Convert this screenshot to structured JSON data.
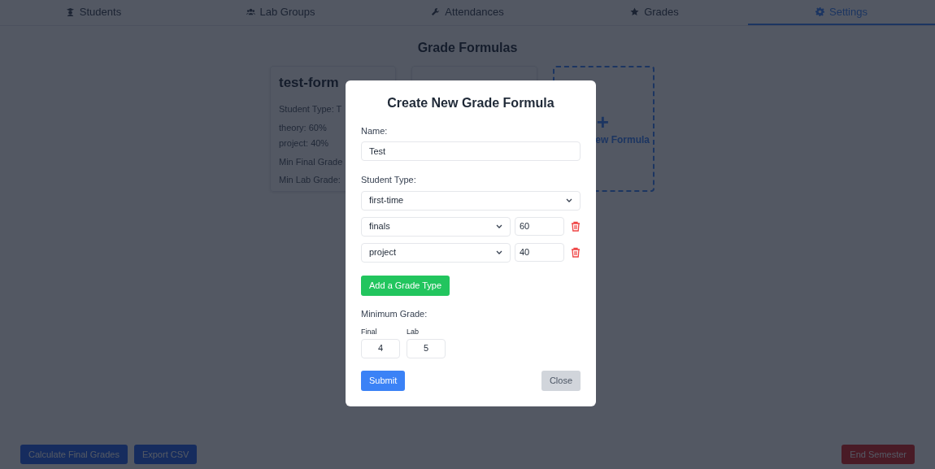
{
  "tabs": [
    {
      "label": "Students",
      "selected": false
    },
    {
      "label": "Lab Groups",
      "selected": false
    },
    {
      "label": "Attendances",
      "selected": false
    },
    {
      "label": "Grades",
      "selected": false
    },
    {
      "label": "Settings",
      "selected": true
    }
  ],
  "page_title": "Grade Formulas",
  "formula_cards": [
    {
      "kind": "formula",
      "title": "test-form",
      "lines": [
        "Student Type: T",
        "theory: 60%",
        "project: 40%",
        "Min Final Grade",
        "Min Lab Grade:"
      ]
    },
    {
      "kind": "hidden"
    },
    {
      "kind": "add",
      "plus": "+",
      "label": "ew Formula"
    }
  ],
  "bottom_buttons": [
    {
      "label": "Calculate Final Grades",
      "kind": "primary"
    },
    {
      "label": "Export CSV",
      "kind": "primary"
    },
    {
      "label": "End Semester",
      "kind": "danger"
    }
  ],
  "modal": {
    "title": "Create New Grade Formula",
    "name_label": "Name:",
    "name_value": "Test",
    "student_type_label": "Student Type:",
    "student_type_value": "first-time",
    "grade_types": [
      {
        "type": "finals",
        "weight": "60"
      },
      {
        "type": "project",
        "weight": "40"
      }
    ],
    "add_button": "Add a Grade Type",
    "minimum_label": "Minimum Grade:",
    "minimums": [
      {
        "label": "Final",
        "value": "4"
      },
      {
        "label": "Lab",
        "value": "5"
      }
    ],
    "submit_button": "Submit",
    "close_button": "Close"
  }
}
